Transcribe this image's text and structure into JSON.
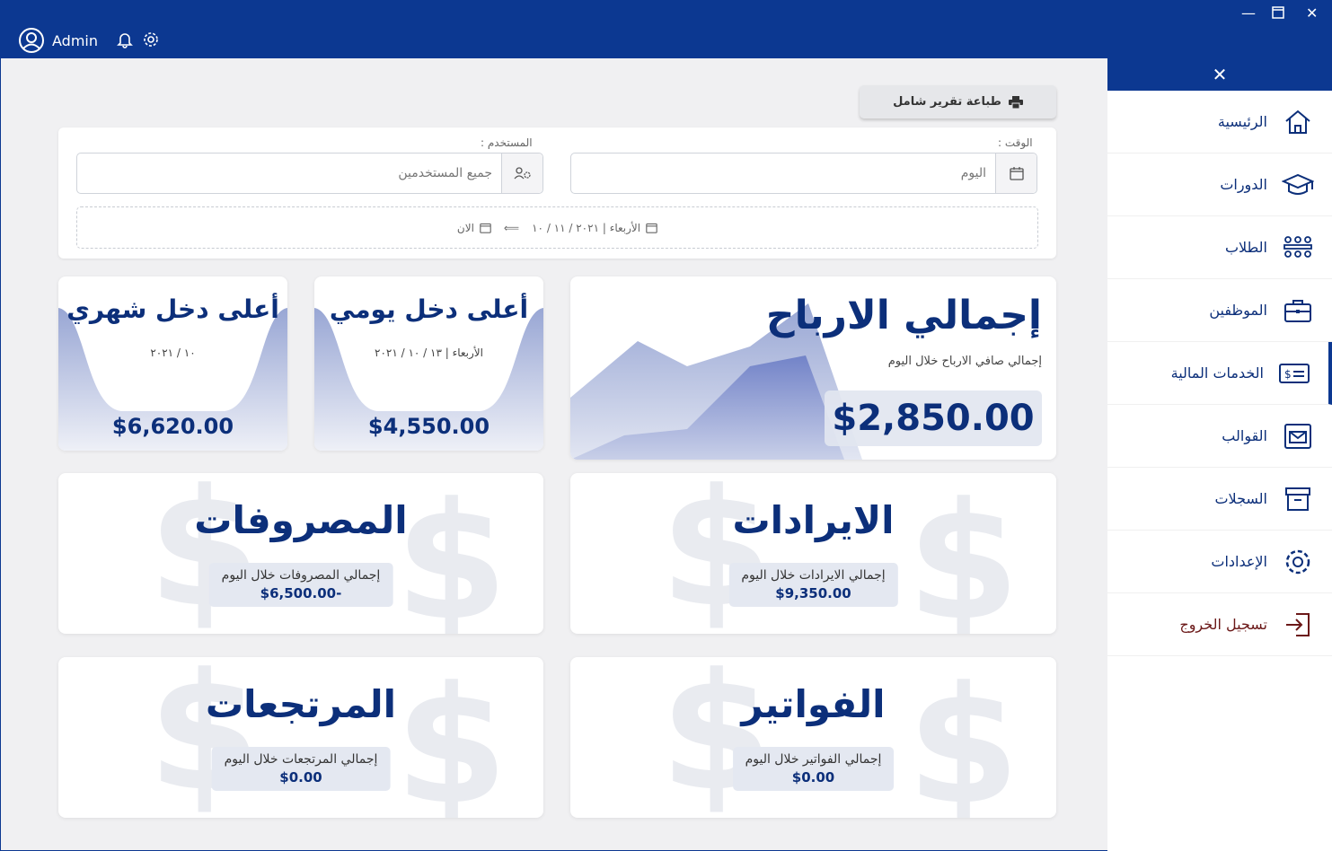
{
  "header": {
    "username": "Admin"
  },
  "toolbar": {
    "print_label": "طباعة تقرير شامل"
  },
  "filters": {
    "user_label": "المستخدم :",
    "user_value": "جميع المستخدمين",
    "time_label": "الوقت :",
    "time_value": "اليوم",
    "range_from": "الأربعاء | ٢٠٢١ / ١١ / ١٠",
    "range_to": "الان"
  },
  "profit": {
    "title": "إجمالي الارباح",
    "subtitle": "إجمالي صافي الارباح خلال اليوم",
    "amount": "$2,850.00"
  },
  "daily": {
    "title": "أعلى دخل يومي",
    "date": "الأربعاء | ١٣ / ١٠ / ٢٠٢١",
    "amount": "$4,550.00"
  },
  "monthly": {
    "title": "أعلى دخل شهري",
    "date": "١٠ / ٢٠٢١",
    "amount": "$6,620.00"
  },
  "revenues": {
    "title": "الايرادات",
    "label": "إجمالي الايرادات خلال اليوم",
    "amount": "$9,350.00"
  },
  "expenses": {
    "title": "المصروفات",
    "label": "إجمالي المصروفات خلال اليوم",
    "amount": "$6,500.00-"
  },
  "invoices": {
    "title": "الفواتير",
    "label": "إجمالي الفواتير خلال اليوم",
    "amount": "$0.00"
  },
  "returns": {
    "title": "المرتجعات",
    "label": "إجمالي المرتجعات خلال اليوم",
    "amount": "$0.00"
  },
  "sidebar": {
    "items": [
      {
        "label": "الرئيسية",
        "icon": "home-icon"
      },
      {
        "label": "الدورات",
        "icon": "graduation-cap-icon"
      },
      {
        "label": "الطلاب",
        "icon": "students-icon"
      },
      {
        "label": "الموظفين",
        "icon": "briefcase-icon"
      },
      {
        "label": "الخدمات المالية",
        "icon": "money-card-icon"
      },
      {
        "label": "القوالب",
        "icon": "mail-icon"
      },
      {
        "label": "السجلات",
        "icon": "archive-icon"
      },
      {
        "label": "الإعدادات",
        "icon": "gear-icon"
      },
      {
        "label": "تسجيل الخروج",
        "icon": "logout-icon"
      }
    ]
  },
  "colors": {
    "primary": "#0c3891",
    "text_dark": "#0c2f7a",
    "logout": "#6b1818"
  }
}
